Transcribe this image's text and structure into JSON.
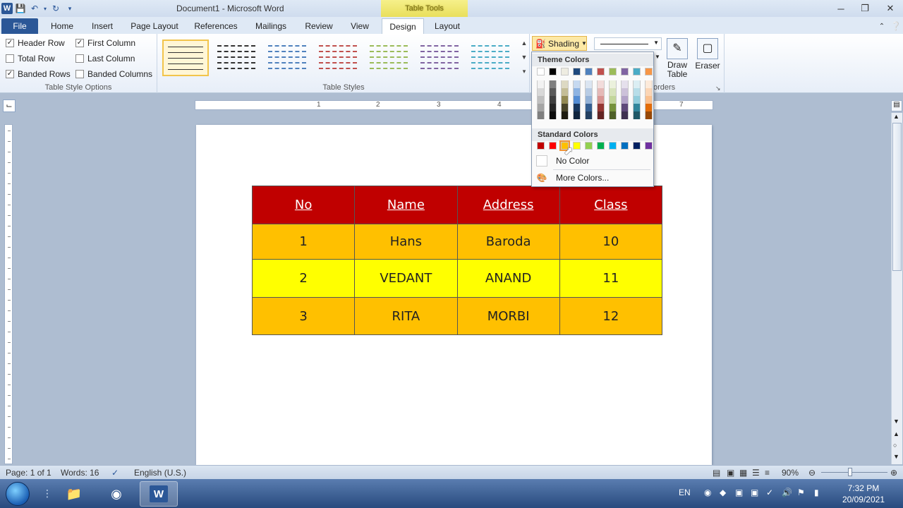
{
  "window": {
    "title": "Document1  -  Microsoft Word",
    "contextual_tab": "Table Tools",
    "app_logo": "W"
  },
  "tabs": [
    "File",
    "Home",
    "Insert",
    "Page Layout",
    "References",
    "Mailings",
    "Review",
    "View",
    "Design",
    "Layout"
  ],
  "active_tab": "Design",
  "ribbon": {
    "table_style_options": {
      "label": "Table Style Options",
      "options": [
        {
          "label": "Header Row",
          "checked": true
        },
        {
          "label": "First Column",
          "checked": true
        },
        {
          "label": "Total Row",
          "checked": false
        },
        {
          "label": "Last Column",
          "checked": false
        },
        {
          "label": "Banded Rows",
          "checked": true
        },
        {
          "label": "Banded Columns",
          "checked": false
        }
      ]
    },
    "table_styles": {
      "label": "Table Styles",
      "thumb_colors": [
        "#333333",
        "#333333",
        "#4f81bd",
        "#c0504d",
        "#9bbb59",
        "#8064a2",
        "#4bacc6"
      ]
    },
    "shading_label": "Shading",
    "borders_label_fragment": "orders",
    "draw_table_label": "Draw Table",
    "eraser_label": "Eraser"
  },
  "ruler": {
    "numbers": [
      "1",
      "2",
      "3",
      "4",
      "7"
    ]
  },
  "table": {
    "header": [
      "No",
      "Name",
      "Address",
      "Class"
    ],
    "rows": [
      [
        "1",
        "Hans",
        "Baroda",
        "10"
      ],
      [
        "2",
        "VEDANT",
        "ANAND",
        "11"
      ],
      [
        "3",
        "RITA",
        "MORBI",
        "12"
      ]
    ],
    "colors": {
      "header": "#c00000",
      "banded": "#ffc000",
      "highlight": "#ffff00"
    }
  },
  "shading_menu": {
    "theme_colors_label": "Theme Colors",
    "theme_top": [
      "#ffffff",
      "#000000",
      "#eeece1",
      "#1f497d",
      "#4f81bd",
      "#c0504d",
      "#9bbb59",
      "#8064a2",
      "#4bacc6",
      "#f79646"
    ],
    "theme_shades": [
      [
        "#f2f2f2",
        "#7f7f7f",
        "#ddd9c3",
        "#c6d9f0",
        "#dbe5f1",
        "#f2dcdb",
        "#ebf1dd",
        "#e5e0ec",
        "#dbeef3",
        "#fdeada"
      ],
      [
        "#d8d8d8",
        "#595959",
        "#c4bd97",
        "#8db3e2",
        "#b8cce4",
        "#e5b9b7",
        "#d7e3bc",
        "#ccc1d9",
        "#b7dde8",
        "#fbd5b5"
      ],
      [
        "#bfbfbf",
        "#3f3f3f",
        "#938953",
        "#548dd4",
        "#95b3d7",
        "#d99694",
        "#c3d69b",
        "#b2a2c7",
        "#92cddc",
        "#fac08f"
      ],
      [
        "#a5a5a5",
        "#262626",
        "#494429",
        "#17365d",
        "#366092",
        "#953734",
        "#76923c",
        "#5f497a",
        "#31859b",
        "#e36c09"
      ],
      [
        "#7f7f7f",
        "#0c0c0c",
        "#1d1b10",
        "#0f243e",
        "#244061",
        "#632423",
        "#4f6128",
        "#3f3151",
        "#205867",
        "#974806"
      ]
    ],
    "standard_colors_label": "Standard Colors",
    "standard": [
      "#c00000",
      "#ff0000",
      "#ffc000",
      "#ffff00",
      "#92d050",
      "#00b050",
      "#00b0f0",
      "#0070c0",
      "#002060",
      "#7030a0"
    ],
    "hovered_standard_index": 2,
    "no_color_label": "No Color",
    "more_colors_label": "More Colors..."
  },
  "statusbar": {
    "page": "Page: 1 of 1",
    "words": "Words: 16",
    "language": "English (U.S.)",
    "zoom": "90%"
  },
  "taskbar": {
    "tray_lang": "EN",
    "time": "7:32 PM",
    "date": "20/09/2021"
  }
}
